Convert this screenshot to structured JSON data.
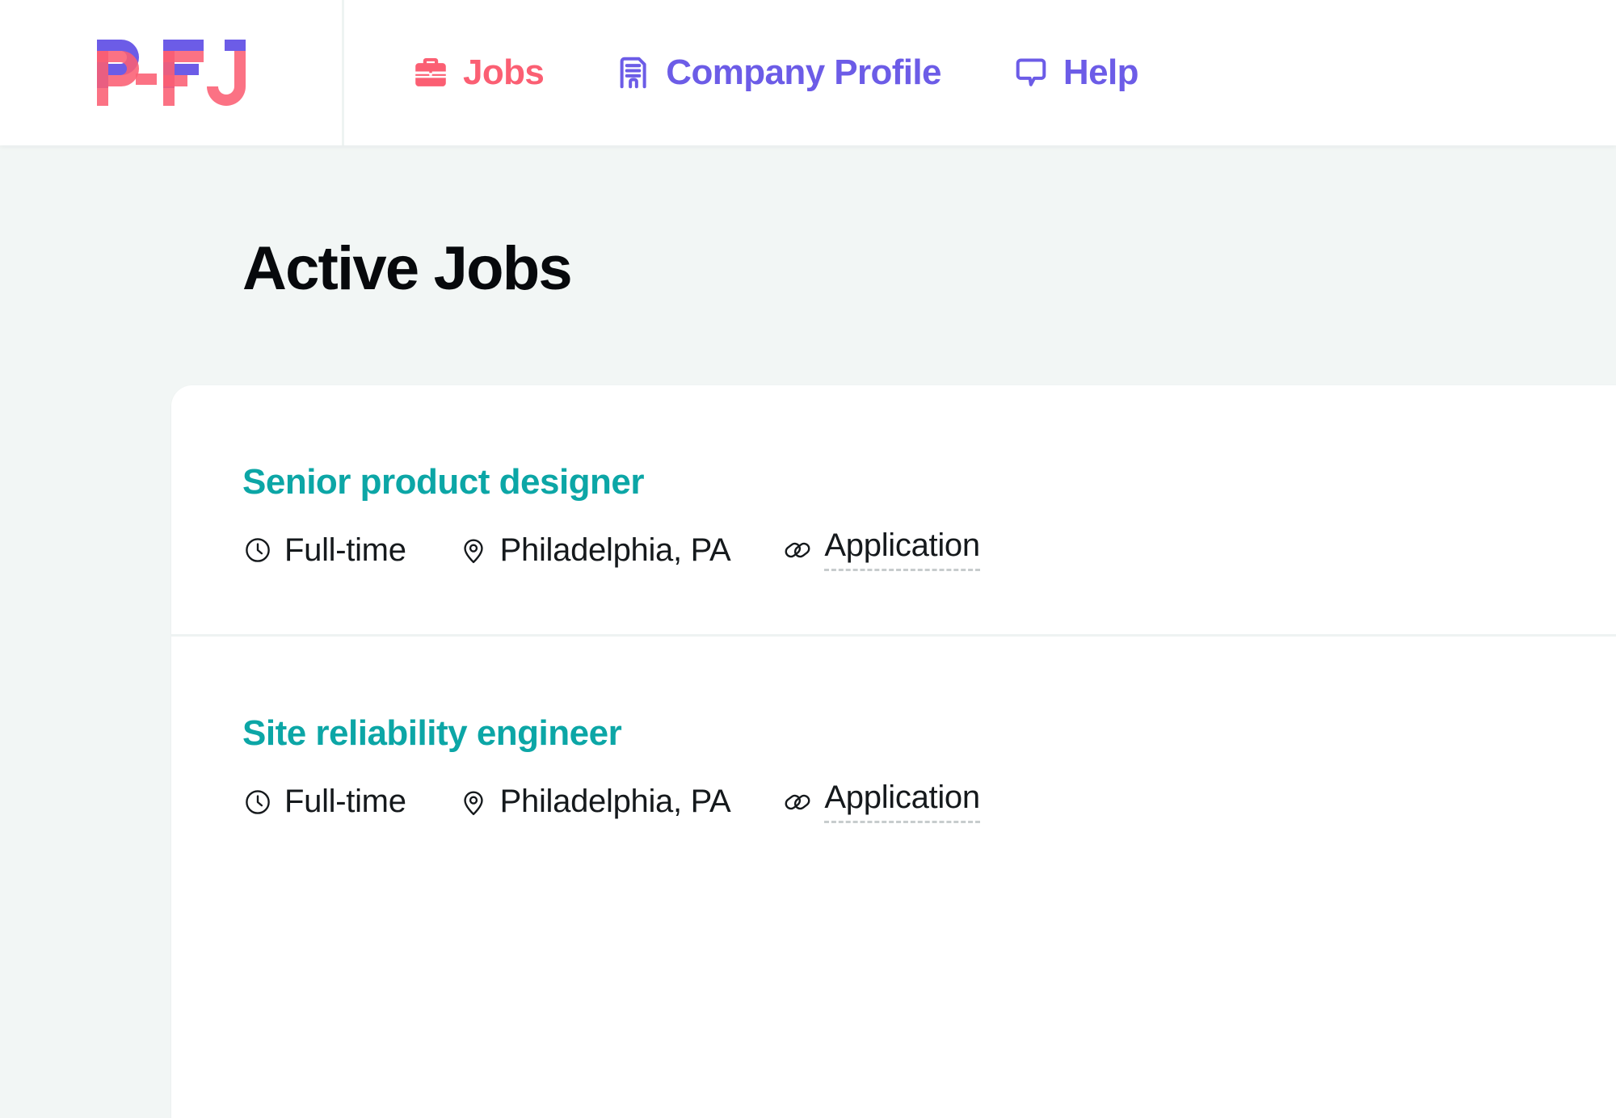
{
  "brand": {
    "logo_text": "P-FJ",
    "logo_pink": "#fb5f73",
    "logo_purple": "#6c5ce7",
    "logo_overlap": "#5b2a63"
  },
  "header": {
    "nav": [
      {
        "label": "Jobs",
        "icon": "briefcase-icon",
        "color": "#fb5f73",
        "active": true
      },
      {
        "label": "Company Profile",
        "icon": "building-icon",
        "color": "#6c5ce7",
        "active": false
      },
      {
        "label": "Help",
        "icon": "chat-bubble-icon",
        "color": "#6c5ce7",
        "active": false
      }
    ]
  },
  "main": {
    "page_title": "Active Jobs",
    "accent_teal": "#0ca6a6",
    "background": "#f2f6f5",
    "jobs": [
      {
        "title": "Senior product designer",
        "employment_type": "Full-time",
        "location": "Philadelphia, PA",
        "link_label": "Application",
        "type_icon": "clock-icon",
        "location_icon": "map-pin-icon",
        "link_icon": "link-icon"
      },
      {
        "title": "Site reliability engineer",
        "employment_type": "Full-time",
        "location": "Philadelphia, PA",
        "link_label": "Application",
        "type_icon": "clock-icon",
        "location_icon": "map-pin-icon",
        "link_icon": "link-icon"
      }
    ]
  }
}
